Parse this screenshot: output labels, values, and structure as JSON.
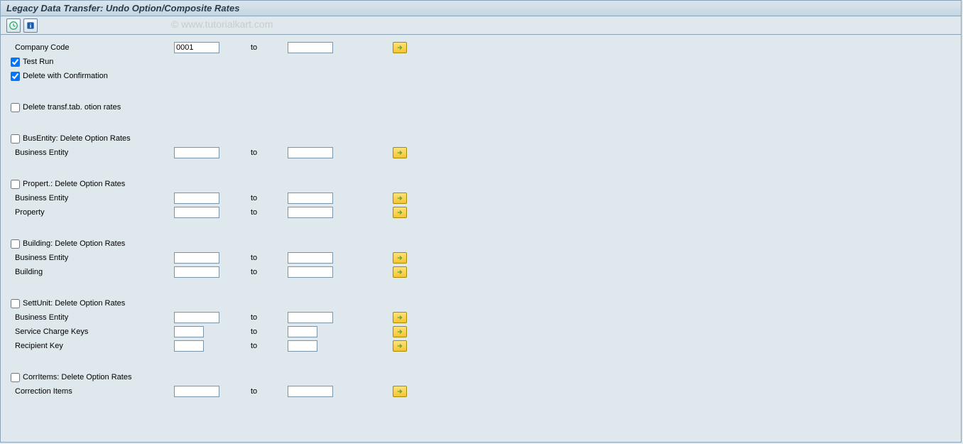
{
  "title": "Legacy Data Transfer: Undo Option/Composite Rates",
  "watermark": "© www.tutorialkart.com",
  "labels": {
    "company_code": "Company Code",
    "to": "to",
    "test_run": "Test Run",
    "delete_confirm": "Delete with Confirmation",
    "delete_transf": "Delete transf.tab. otion rates",
    "busentity_chk": "BusEntity: Delete Option Rates",
    "business_entity": "Business Entity",
    "propert_chk": "Propert.: Delete Option Rates",
    "property": "Property",
    "building_chk": "Building: Delete Option Rates",
    "building": "Building",
    "settunit_chk": "SettUnit: Delete Option Rates",
    "service_charge_keys": "Service Charge Keys",
    "recipient_key": "Recipient Key",
    "corritems_chk": "CorrItems: Delete Option Rates",
    "correction_items": "Correction Items"
  },
  "values": {
    "company_code_from": "0001",
    "company_code_to": "",
    "test_run_checked": true,
    "delete_confirm_checked": true,
    "delete_transf_checked": false,
    "busentity_checked": false,
    "be1_from": "",
    "be1_to": "",
    "propert_checked": false,
    "be2_from": "",
    "be2_to": "",
    "property_from": "",
    "property_to": "",
    "building_checked": false,
    "be3_from": "",
    "be3_to": "",
    "building_from": "",
    "building_to": "",
    "settunit_checked": false,
    "be4_from": "",
    "be4_to": "",
    "sck_from": "",
    "sck_to": "",
    "rk_from": "",
    "rk_to": "",
    "corritems_checked": false,
    "ci_from": "",
    "ci_to": ""
  }
}
